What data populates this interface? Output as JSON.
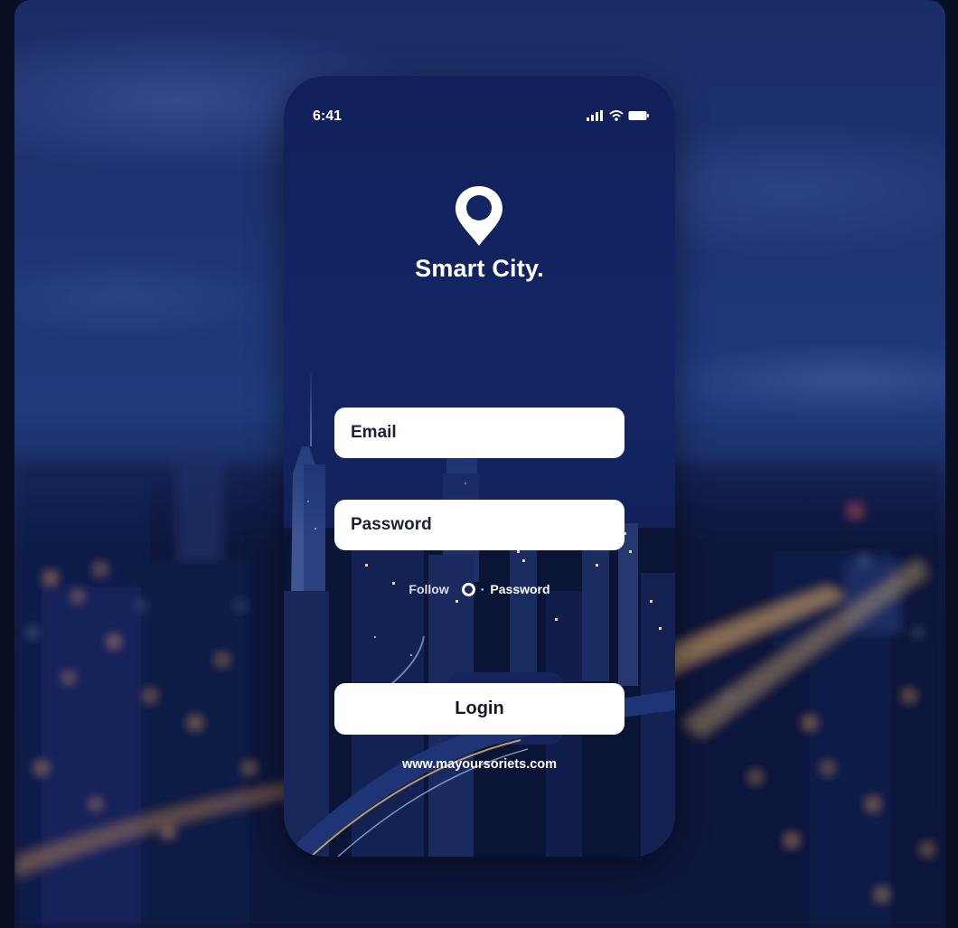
{
  "status_bar": {
    "time": "6:41",
    "icons": [
      "signal-icon",
      "wifi-icon",
      "battery-icon"
    ]
  },
  "brand": {
    "logo_icon": "location-pin-icon",
    "title": "Smart City."
  },
  "form": {
    "email_placeholder": "Email",
    "password_placeholder": "Password",
    "follow_label": "Follow",
    "password_option_label": "Password",
    "login_label": "Login"
  },
  "footer": {
    "website": "www.mayoursoriets.com"
  },
  "colors": {
    "phone_background": "#132563",
    "field_background": "#ffffff",
    "text_on_dark": "#ffffff",
    "text_on_light": "#1c2238"
  }
}
